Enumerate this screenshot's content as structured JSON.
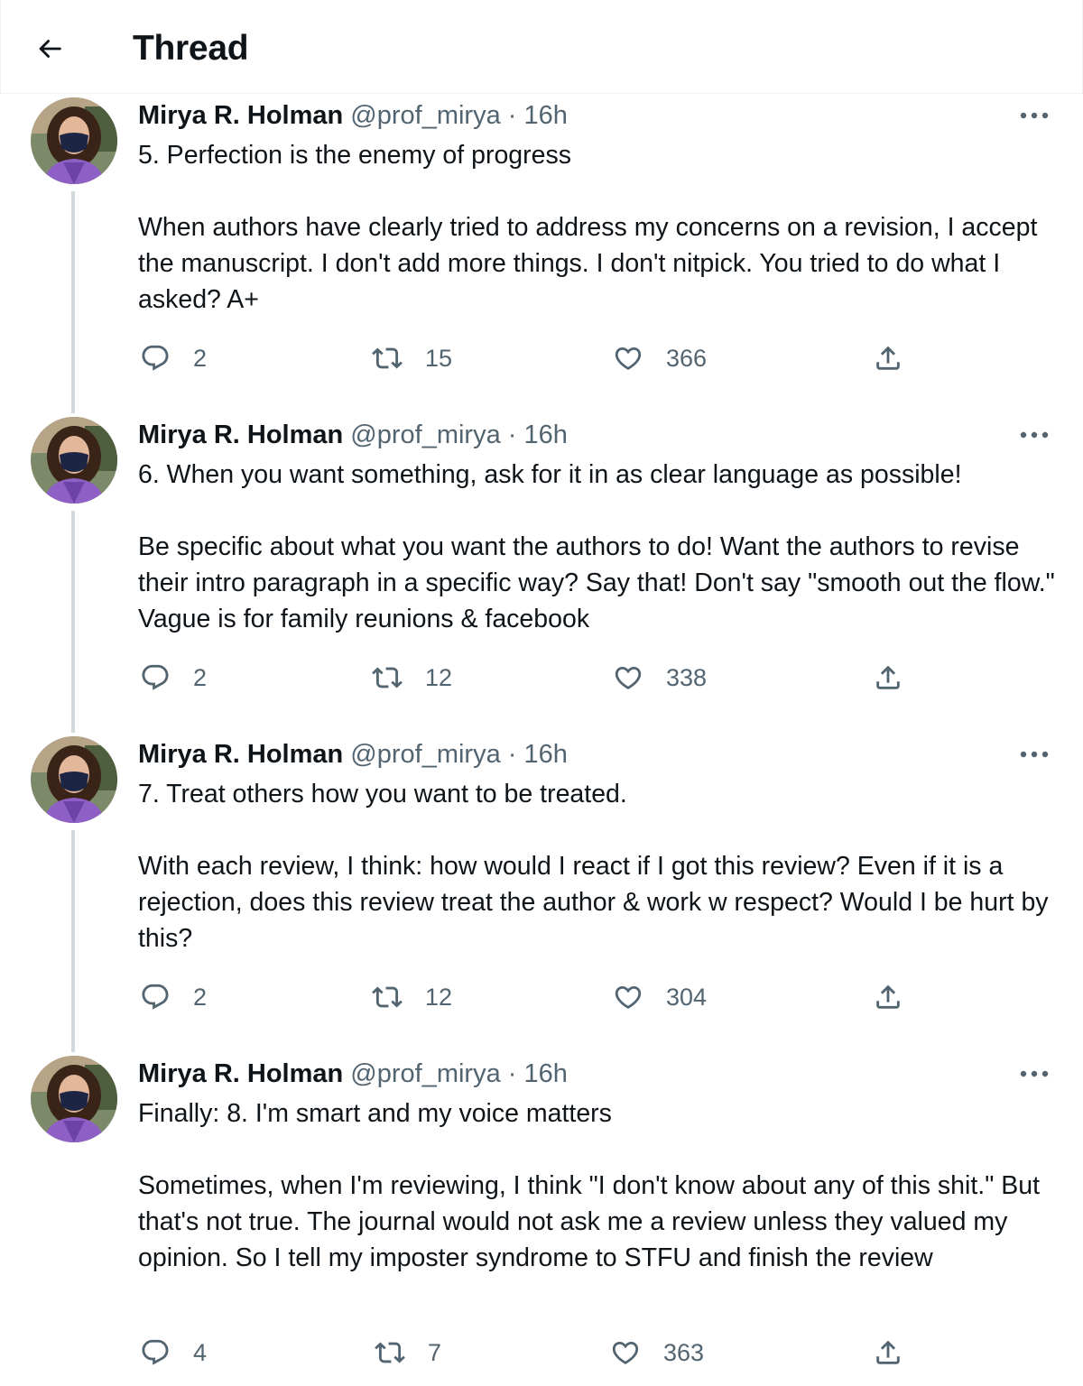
{
  "header": {
    "title": "Thread",
    "back_icon": "arrow-left-icon"
  },
  "tweets": [
    {
      "name": "Mirya R. Holman",
      "handle": "@prof_mirya",
      "separator": "·",
      "time": "16h",
      "text": "5. Perfection is the enemy of progress\n\nWhen authors have clearly tried to address my concerns on a revision, I accept the manuscript. I don't add more things. I don't nitpick. You tried to do what I asked? A+",
      "replies": "2",
      "retweets": "15",
      "likes": "366"
    },
    {
      "name": "Mirya R. Holman",
      "handle": "@prof_mirya",
      "separator": "·",
      "time": "16h",
      "text": "6. When you want something, ask for it in as clear language as possible!\n\nBe specific about what you want the authors to do! Want the authors to revise their intro paragraph in a specific way? Say that! Don't say \"smooth out the flow.\" Vague is for family reunions & facebook",
      "replies": "2",
      "retweets": "12",
      "likes": "338"
    },
    {
      "name": "Mirya R. Holman",
      "handle": "@prof_mirya",
      "separator": "·",
      "time": "16h",
      "text": "7. Treat others how you want to be treated.\n\nWith each review, I think: how would I react if I got this review? Even if it is a rejection, does this review treat the author & work w respect? Would I be hurt by this?",
      "replies": "2",
      "retweets": "12",
      "likes": "304"
    },
    {
      "name": "Mirya R. Holman",
      "handle": "@prof_mirya",
      "separator": "·",
      "time": "16h",
      "text": "Finally: 8. I'm smart and my voice matters\n\nSometimes, when I'm reviewing, I think \"I don't know about any of this shit.\" But that's not true. The journal would not ask me a review unless they valued my opinion. So I tell my imposter syndrome to STFU and finish the review",
      "replies": "4",
      "retweets": "7",
      "likes": "363"
    }
  ],
  "icons": {
    "reply": "reply-icon",
    "retweet": "retweet-icon",
    "like": "heart-icon",
    "share": "share-icon",
    "more": "more-icon"
  },
  "colors": {
    "text": "#0f1419",
    "secondary": "#536471",
    "thread_line": "#cfd9de",
    "divider": "#eff3f4"
  }
}
